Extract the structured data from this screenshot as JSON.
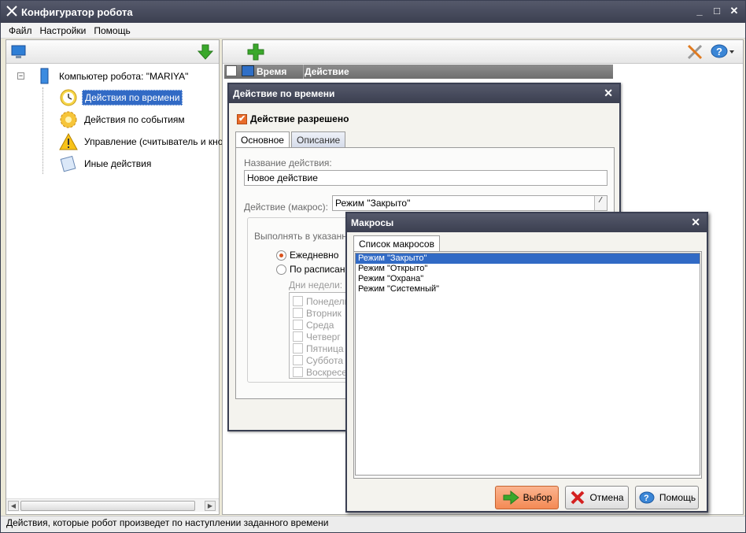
{
  "window": {
    "title": "Конфигуратор робота"
  },
  "menu": [
    "Файл",
    "Настройки",
    "Помощь"
  ],
  "tree": {
    "root": "Компьютер робота: \"MARIYA\"",
    "items": [
      {
        "label": "Действия по времени",
        "icon": "clock-icon"
      },
      {
        "label": "Действия по событиям",
        "icon": "gear-icon"
      },
      {
        "label": "Управление (считыватель и кноп",
        "icon": "warning-icon"
      },
      {
        "label": "Иные действия",
        "icon": "note-icon"
      }
    ]
  },
  "grid": {
    "col_time": "Время",
    "col_action": "Действие"
  },
  "status": "Действия, которые робот произведет по наступлении заданного времени",
  "dialog_time": {
    "title": "Действие по времени",
    "enabled_label": "Действие разрешено",
    "tabs": [
      "Основное",
      "Описание"
    ],
    "name_label": "Название действия:",
    "name_value": "Новое действие",
    "macro_label": "Действие (макрос):",
    "macro_value": "Режим \"Закрыто\"",
    "group_label": "Выполнять в указанное",
    "radio_daily": "Ежедневно",
    "radio_schedule": "По расписанию",
    "days_label": "Дни недели:",
    "days": [
      "Понедельник",
      "Вторник",
      "Среда",
      "Четверг",
      "Пятница",
      "Суббота",
      "Воскресенье"
    ]
  },
  "dialog_macros": {
    "title": "Макросы",
    "tab": "Список макросов",
    "items": [
      "Режим \"Закрыто\"",
      "Режим \"Открыто\"",
      "Режим \"Охрана\"",
      "Режим \"Системный\""
    ],
    "btn_select": "Выбор",
    "btn_cancel": "Отмена",
    "btn_help": "Помощь"
  }
}
